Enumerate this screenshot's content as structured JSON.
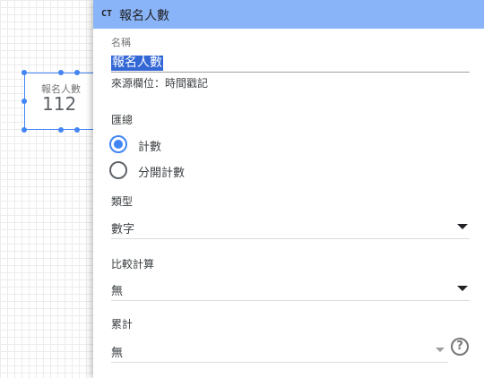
{
  "scorecard": {
    "label": "報名人數",
    "value": "112"
  },
  "panel": {
    "type_icon": "CT",
    "title": "報名人數"
  },
  "name_field": {
    "label": "名稱",
    "value": "報名人數"
  },
  "source": {
    "text": "來源欄位：時間戳記"
  },
  "aggregation": {
    "label": "匯總",
    "options": [
      {
        "label": "計數",
        "checked": true
      },
      {
        "label": "分開計數",
        "checked": false
      }
    ]
  },
  "type_select": {
    "label": "類型",
    "value": "數字"
  },
  "comparison_select": {
    "label": "比較計算",
    "value": "無"
  },
  "cumulative_select": {
    "label": "累計",
    "value": "無"
  },
  "help": {
    "glyph": "?"
  },
  "colors": {
    "header": "#8ab4f8",
    "accent": "#4285f4",
    "selection": "#3367d6"
  },
  "icons": {
    "type_icon": "text-type-icon",
    "help_icon": "help-circle-icon",
    "dropdown": "chevron-down-icon"
  }
}
